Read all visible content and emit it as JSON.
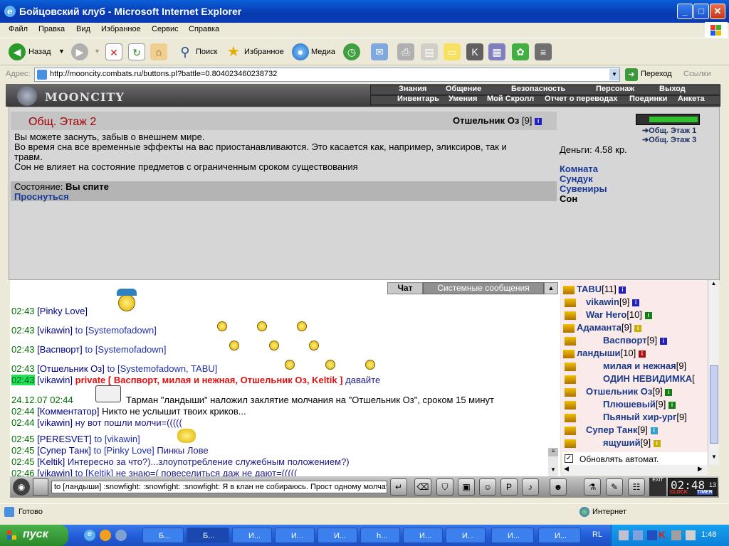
{
  "window": {
    "title": "Бойцовский клуб - Microsoft Internet Explorer",
    "icon": "ie-icon",
    "min": "_",
    "max": "□",
    "close": "✕"
  },
  "menu": [
    "Файл",
    "Правка",
    "Вид",
    "Избранное",
    "Сервис",
    "Справка"
  ],
  "toolbar": {
    "back": "Назад",
    "search": "Поиск",
    "favorites": "Избранное",
    "media": "Медиа"
  },
  "address": {
    "label": "Адрес:",
    "url": "http://mooncity.combats.ru/buttons.pl?battle=0.804023460238732",
    "go": "Переход",
    "links": "Ссылки"
  },
  "game": {
    "logo": "MOONCITY",
    "nav_top": [
      "Знания",
      "Общение",
      "Безопасность",
      "Персонаж",
      "Выход"
    ],
    "nav_bottom": [
      "Инвентарь",
      "Умения",
      "Мой Скролл",
      "Отчет о переводах",
      "Поединки",
      "Анкета"
    ]
  },
  "room": {
    "title": "Общ. Этаж 2",
    "owner_name": "Отшельник Оз",
    "owner_level": "[9]",
    "info": "i",
    "exits": [
      "Общ. Этаж 1",
      "Общ. Этаж 3"
    ],
    "sleep_lines": [
      "Вы можете заснуть, забыв о внешнем мире.",
      "Во время сна все временные эффекты на вас приостанавливаются. Это касается как, например, эликсиров, так и",
      "травм.",
      "Сон не влияет на состояние предметов с ограниченным сроком существования"
    ],
    "state_label": "Состояние:",
    "state_value": "Вы спите",
    "wake_link": "Проснуться",
    "money": "Деньги: 4.58 кр.",
    "links": [
      "Комната",
      "Сундук",
      "Сувениры",
      "Сон"
    ]
  },
  "chat_tabs": {
    "chat": "Чат",
    "system": "Системные сообщения"
  },
  "chat": [
    {
      "time": "02:43",
      "name": "[Pinky Love]",
      "to": "",
      "text": ""
    },
    {
      "time": "02:43",
      "name": "[vikawin]",
      "to": "to [Systemofadown]",
      "text": ""
    },
    {
      "time": "02:43",
      "name": "[Васпворт]",
      "to": "to [Systemofadown]",
      "text": ""
    },
    {
      "time": "02:43",
      "name": "[Отшельник Оз]",
      "to": "to [Systemofadown, TABU]",
      "text": ""
    },
    {
      "time": "02:43",
      "name": "[vikawin]",
      "to": "private [ Васпворт, милая и нежная, Отшельник Оз, Keltik ]",
      "text": "давайте"
    },
    {
      "time": "24.12.07 02:44",
      "name": "",
      "to": "",
      "text": "Тарман \"ландыши\" наложил заклятие молчания на \"Отшельник Оз\", сроком 15 минут"
    },
    {
      "time": "02:44",
      "name": "[Комментатор]",
      "to": "",
      "text": "Никто не услышит твоих криков..."
    },
    {
      "time": "02:44",
      "name": "[vikawin]",
      "to": "",
      "text": "ну вот пошли молчи=((((("
    },
    {
      "time": "02:45",
      "name": "[PERESVET]",
      "to": "to [vikawin]",
      "text": ""
    },
    {
      "time": "02:45",
      "name": "[Супер Танк]",
      "to": "to [Pinky Love]",
      "text": "Пинкы Лове"
    },
    {
      "time": "02:45",
      "name": "[Keltik]",
      "to": "",
      "text": "Интересно за что?)...злоупотребление служебным положением?)"
    },
    {
      "time": "02:46",
      "name": "[vikawin]",
      "to": "to [Keltik]",
      "text": "не знаю=( повеселиться даж не дают=((((("
    }
  ],
  "users": [
    {
      "name": "TABU",
      "level": "[11]"
    },
    {
      "name": "vikawin",
      "level": "[9]"
    },
    {
      "name": "War Hero",
      "level": "[10]"
    },
    {
      "name": "Адаманта",
      "level": "[9]"
    },
    {
      "name": "Васпворт",
      "level": "[9]"
    },
    {
      "name": "ландыши",
      "level": "[10]"
    },
    {
      "name": "милая и нежная",
      "level": "[9]"
    },
    {
      "name": "ОДИН НЕВИДИМКА",
      "level": "["
    },
    {
      "name": "Отшельник Оз",
      "level": "[9]"
    },
    {
      "name": "Плюшевый",
      "level": "[9]"
    },
    {
      "name": "Пьяный хир-ург",
      "level": "[9]"
    },
    {
      "name": "Супер Танк",
      "level": "[9]"
    },
    {
      "name": "ящуший",
      "level": "[9]"
    }
  ],
  "auto_refresh": "Обновлять автомат.",
  "chat_input": "to [ландыши] :snowfight: :snowfight: :snowfight: Я в клан не собираюсь. Прост одному молчать ску",
  "clock": {
    "time": "02:48",
    "seconds": "13",
    "label1": "CLOCK",
    "label2": "TIMER",
    "exit": "EXIT"
  },
  "statusbar": {
    "left": "Готово",
    "right": "Интернет"
  },
  "taskbar": {
    "start": "пуск",
    "tasks": [
      "Б...",
      "Б...",
      "И...",
      "И...",
      "И...",
      "h...",
      "И...",
      "И...",
      "И...",
      "И..."
    ],
    "lang": "RL",
    "time": "1:48"
  }
}
